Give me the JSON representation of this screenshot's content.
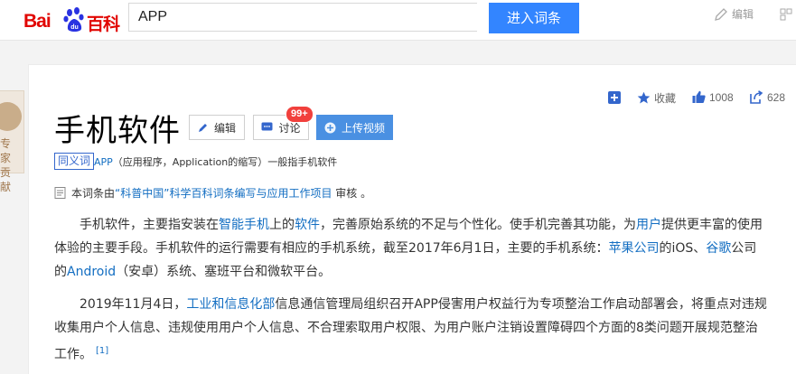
{
  "header": {
    "logo_bai": "Bai",
    "logo_du": "du",
    "logo_baike": "百科",
    "search_value": "APP",
    "search_button": "进入词条",
    "edit_label": "编辑"
  },
  "left_badge": {
    "label": "专家贡献"
  },
  "title": "手机软件",
  "buttons": {
    "edit": "编辑",
    "discuss": "讨论",
    "discuss_badge": "99+",
    "upload_video": "上传视频"
  },
  "stats": {
    "favorite_label": "收藏",
    "like_count": "1008",
    "share_count": "628"
  },
  "synonym": {
    "tag": "同义词",
    "term": "APP",
    "rest": "（应用程序，Application的缩写）一般指手机软件"
  },
  "review": {
    "prefix": "本词条由",
    "link": "“科普中国”科学百科词条编写与应用工作项目",
    "suffix": " 审核 。"
  },
  "para1": {
    "s1": "手机软件，主要指安装在",
    "l1": "智能手机",
    "s2": "上的",
    "l2": "软件",
    "s3": "，完善原始系统的不足与个性化。使手机完善其功能，为",
    "l3": "用户",
    "s4": "提供更丰富的使用体验的主要手段。手机软件的运行需要有相应的手机系统，截至2017年6月1日，主要的手机系统：",
    "l4": "苹果公司",
    "s5": "的iOS、",
    "l5": "谷歌",
    "s6": "公司的",
    "l6": "Android",
    "s7": "（安卓）系统、塞班平台和微软平台。"
  },
  "para2": {
    "s1": "2019年11月4日，",
    "l1": "工业和信息化部",
    "s2": "信息通信管理局组织召开APP侵害用户权益行为专项整治工作启动部署会，将重点对违规收集用户个人信息、违规使用用户个人信息、不合理索取用户权限、为用户账户注销设置障碍四个方面的8类问题开展规范整治工作。",
    "ref": "[1]"
  },
  "colors": {
    "brand_red": "#e10602",
    "search_blue": "#3385ff",
    "link_blue": "#136ec2"
  }
}
